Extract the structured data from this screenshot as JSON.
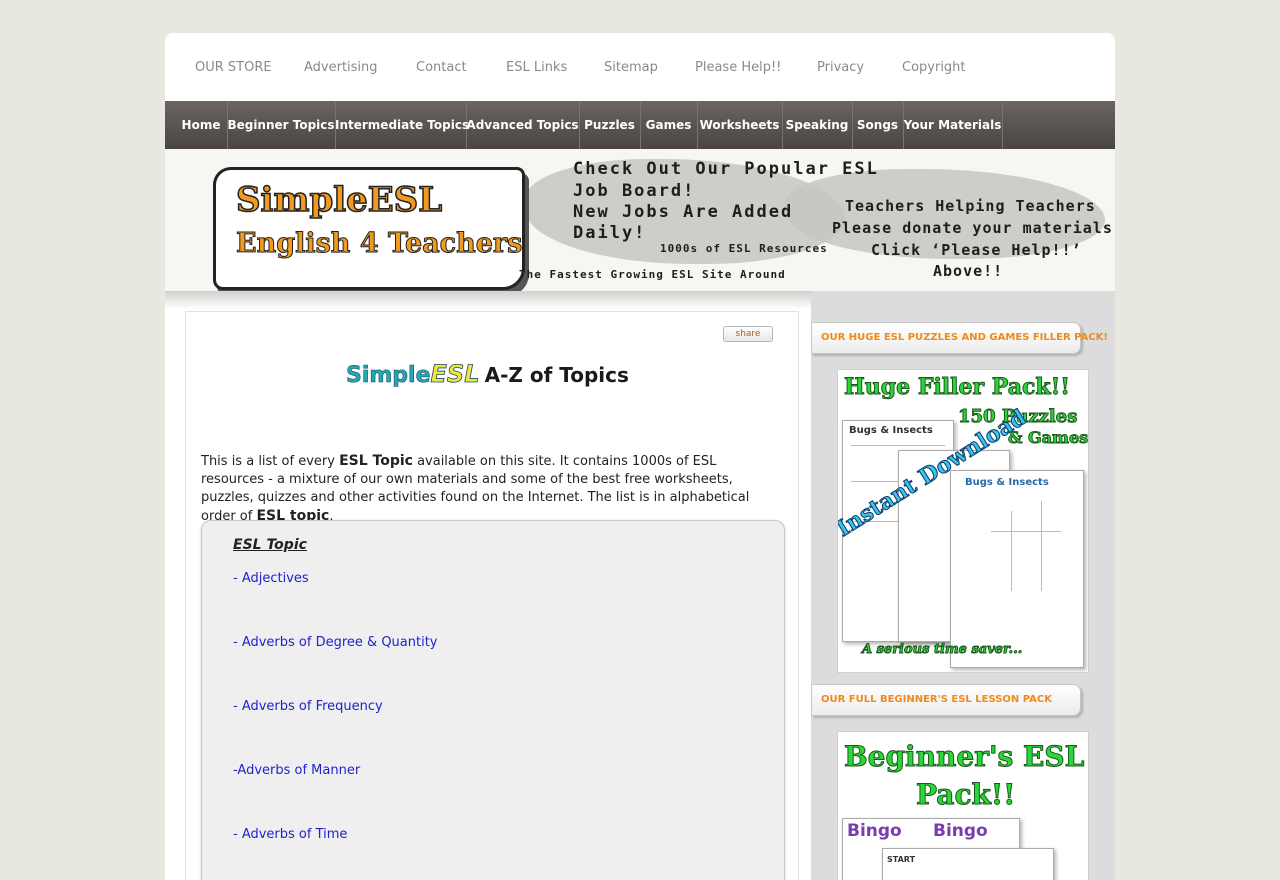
{
  "top_nav": [
    "OUR STORE",
    "Advertising",
    "Contact",
    "ESL Links",
    "Sitemap",
    "Please Help!!",
    "Privacy",
    "Copyright"
  ],
  "main_nav": [
    "Home",
    "Beginner Topics",
    "Intermediate Topics",
    "Advanced Topics",
    "Puzzles",
    "Games",
    "Worksheets",
    "Speaking",
    "Songs",
    "Your Materials"
  ],
  "banner": {
    "logo_line1": "SimpleESL",
    "logo_line2": "English 4 Teachers",
    "job_line1": "Check Out Our Popular ESL",
    "job_line2": "Job Board!",
    "job_line3": "New Jobs Are Added",
    "job_line4": "Daily!",
    "resources": "1000s of ESL Resources",
    "tagline": "The Fastest Growing ESL Site Around",
    "donate_line1": "Teachers Helping Teachers",
    "donate_line2": "Please donate your materials",
    "donate_line3": "Click ‘Please Help!!’",
    "donate_line4": "Above!!"
  },
  "content": {
    "share_label": "share",
    "title_simple": "Simple",
    "title_esl": "ESL",
    "title_rest": "A-Z of Topics",
    "intro_part1": "This is a list of every ",
    "intro_bold1": "ESL Topic",
    "intro_part2": " available on this site. It contains 1000s of ESL resources - a mixture of our own materials and some of the best free worksheets, puzzles, quizzes and other activities found on the Internet. The list is in alphabetical order of ",
    "intro_bold2": "ESL topic",
    "intro_part3": ".",
    "topic_heading": "ESL Topic",
    "topics": [
      "- Adjectives",
      "- Adverbs of Degree & Quantity",
      "- Adverbs of Frequency",
      "-Adverbs of Manner",
      "- Adverbs of Time"
    ]
  },
  "sidebar": {
    "tab1": "OUR HUGE ESL PUZZLES AND GAMES FILLER PACK!",
    "tab2": "OUR FULL BEGINNER'S ESL LESSON PACK",
    "promo1_title1": "Huge Filler Pack!!",
    "promo1_title2": "150 Puzzles",
    "promo1_title3": "& Games",
    "promo1_sheet1": "Bugs & Insects",
    "promo1_sheet2": "Bugs & Insects",
    "promo1_diag": "Instant Download",
    "promo1_footer": "A serious time saver...",
    "promo2_title1": "Beginner's ESL",
    "promo2_title2": "Pack!!",
    "promo2_bingo1": "Bingo",
    "promo2_bingo2": "Bingo",
    "promo2_start": "START"
  }
}
